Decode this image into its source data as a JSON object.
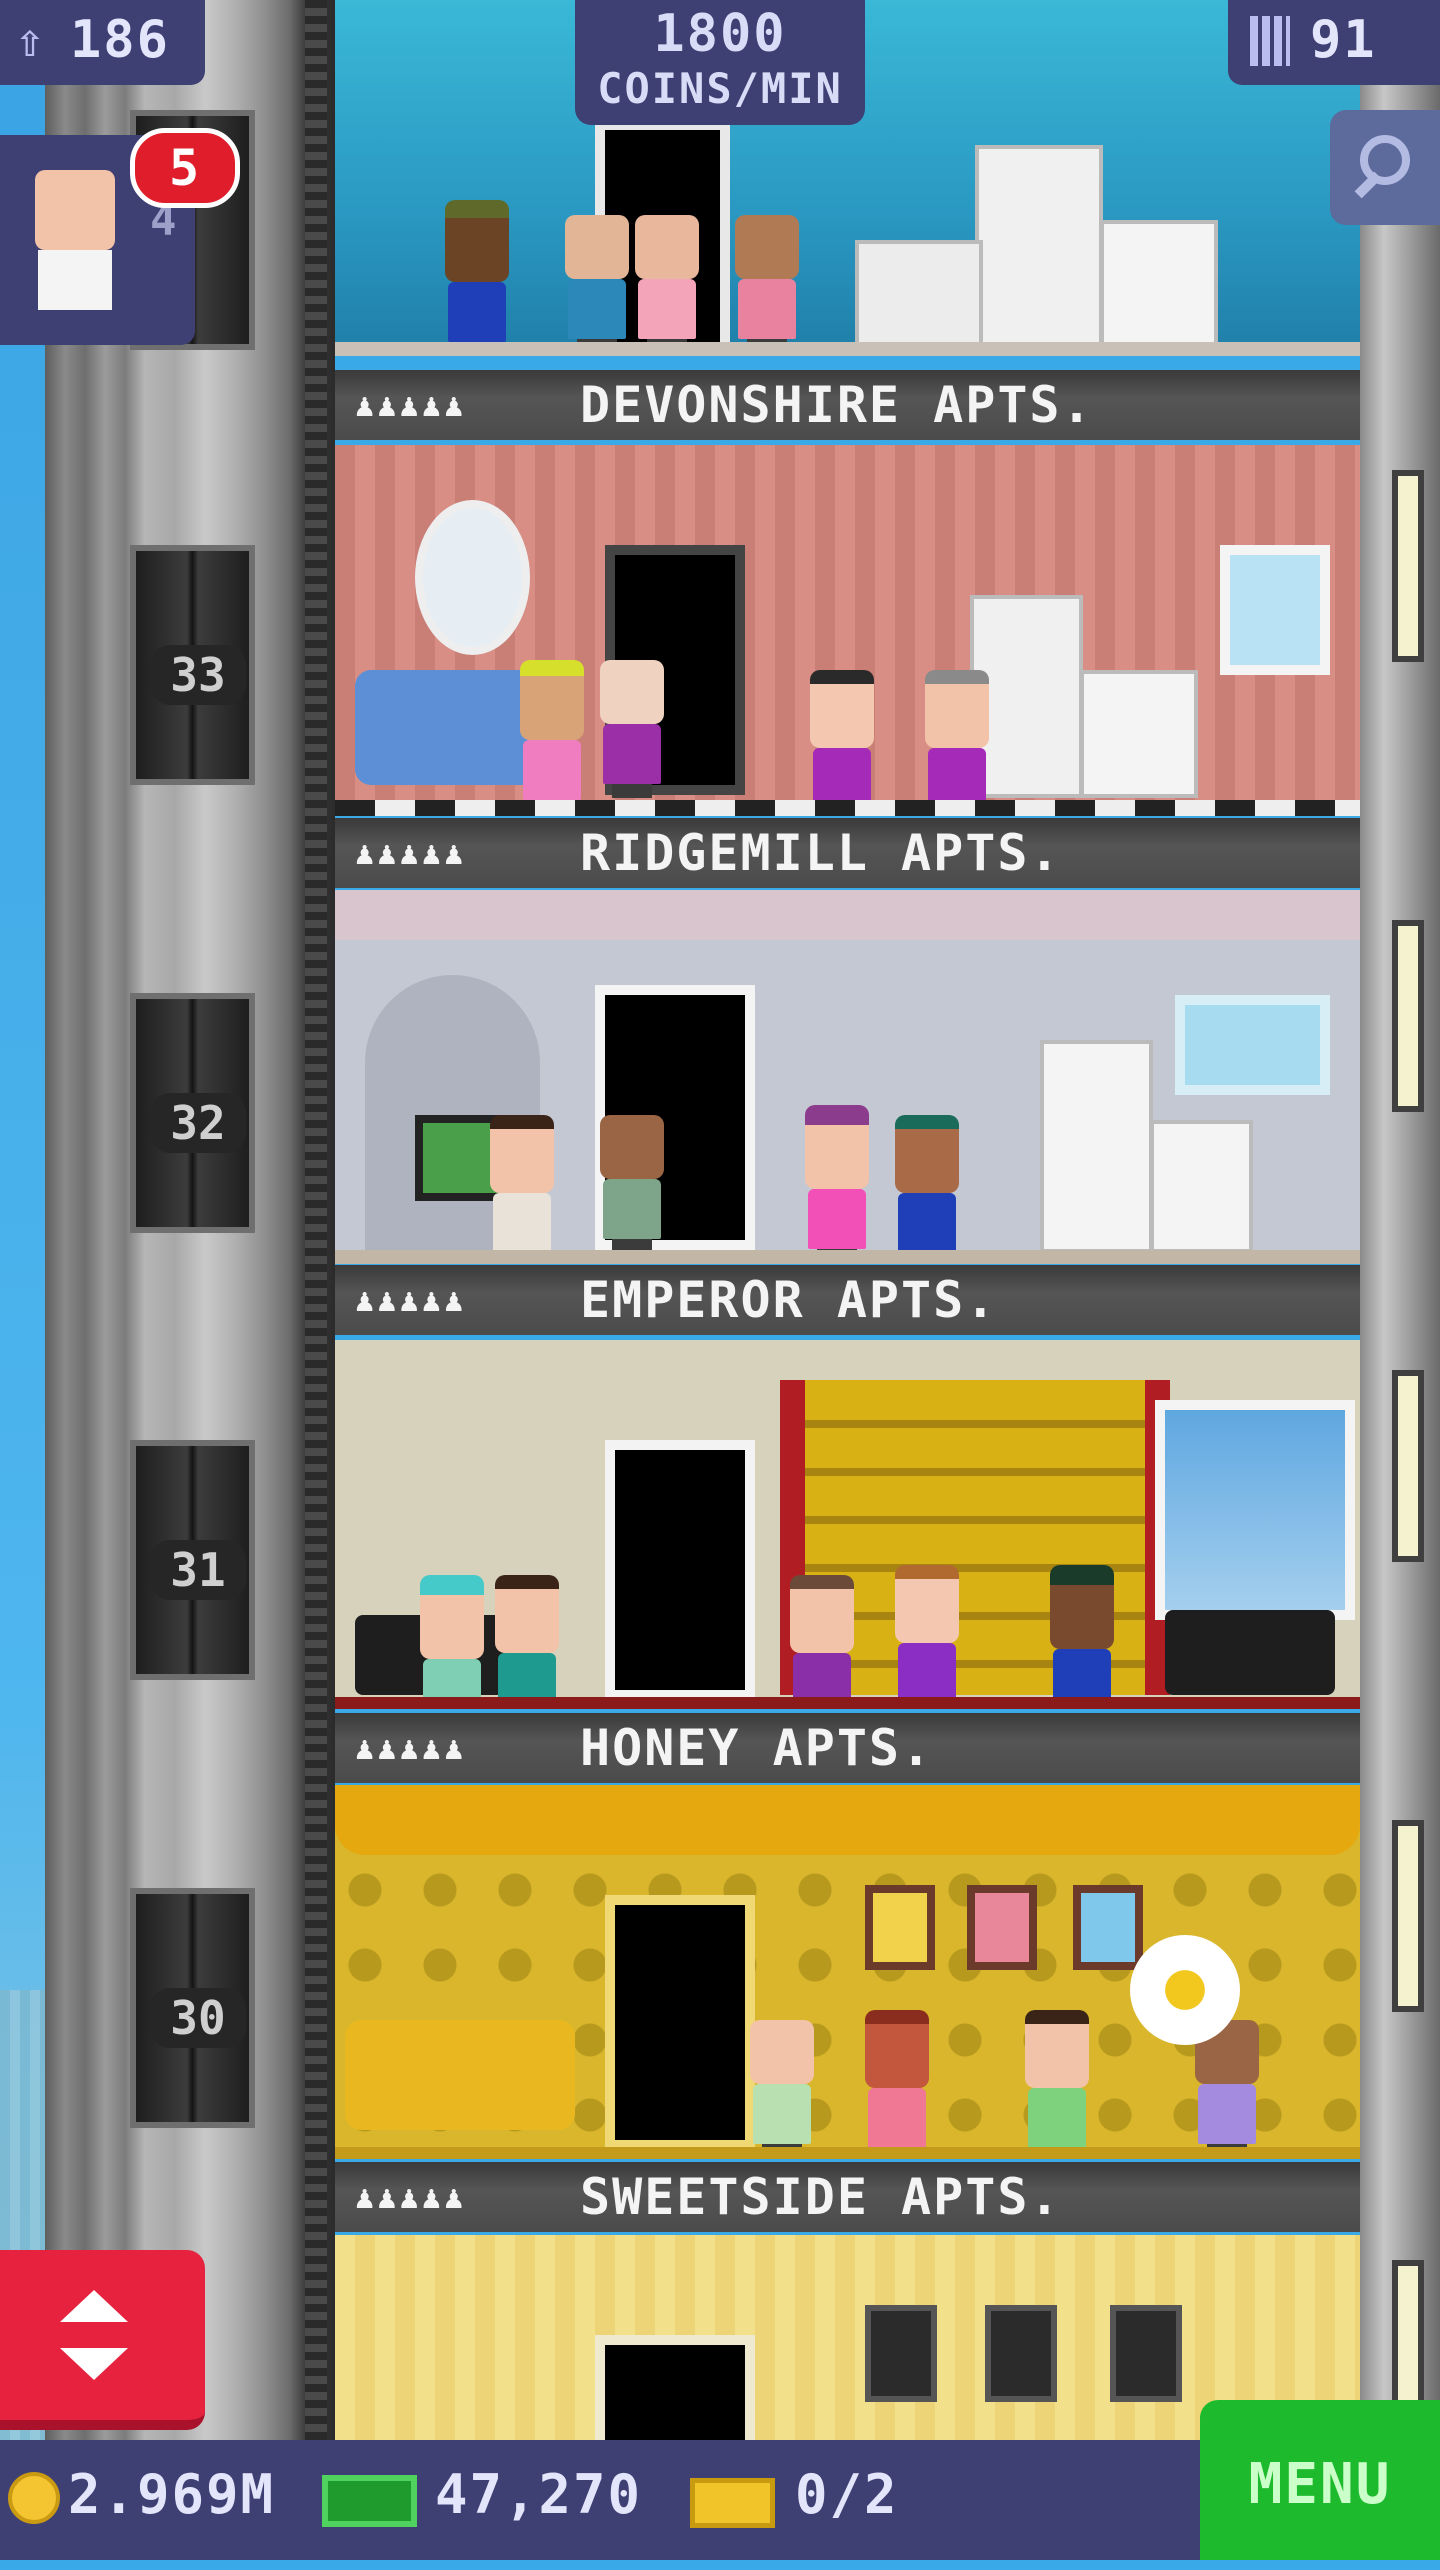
{
  "hud": {
    "bitizens": "186",
    "coins_rate_value": "1800",
    "coins_rate_unit": "COINS/MIN",
    "floors": "91",
    "notification_count": "5",
    "avatar_floor_hint": "4"
  },
  "elevator": {
    "floor_numbers": [
      "33",
      "32",
      "31",
      "30"
    ]
  },
  "floors": [
    {
      "name": "DEVONSHIRE APTS.",
      "rating": "♟♟♟♟♟"
    },
    {
      "name": "RIDGEMILL APTS.",
      "rating": "♟♟♟♟♟"
    },
    {
      "name": "EMPEROR APTS.",
      "rating": "♟♟♟♟♟"
    },
    {
      "name": "HONEY APTS.",
      "rating": "♟♟♟♟♟"
    },
    {
      "name": "SWEETSIDE APTS.",
      "rating": "♟♟♟♟♟"
    }
  ],
  "bottom": {
    "coins": "2.969M",
    "bux": "47,270",
    "tickets": "0/2",
    "menu_label": "MENU"
  },
  "icons": {
    "bitizen": "person-up-icon",
    "floors": "building-icon",
    "zoom": "magnifier-icon",
    "elevator": "up-down-arrows-icon",
    "coin": "coin-icon",
    "bux": "cash-icon",
    "ticket": "ticket-icon"
  },
  "colors": {
    "hud_bg": "#3e3f73",
    "menu_green": "#1dba2d",
    "elevator_red": "#e6223f",
    "badge_red": "#e01d2a"
  }
}
